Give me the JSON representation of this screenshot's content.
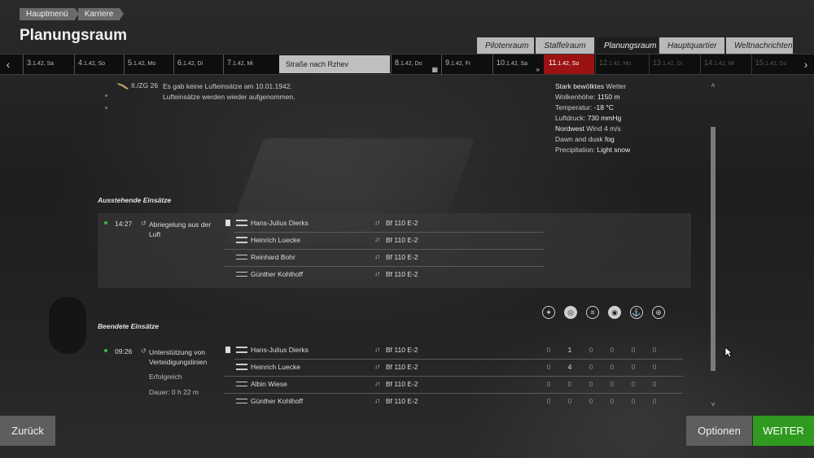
{
  "breadcrumb": [
    "Hauptmenü",
    "Karriere"
  ],
  "page_title": "Planungsraum",
  "tabs": [
    {
      "label": "Pilotenraum",
      "active": false
    },
    {
      "label": "Staffelraum",
      "active": false
    },
    {
      "label": "Planungsraum",
      "active": true
    },
    {
      "label": "Hauptquartier",
      "active": false
    },
    {
      "label": "Weltnachrichten",
      "active": false
    }
  ],
  "datebar": {
    "days": [
      {
        "num": "3",
        "rest": ".1.42, Sa"
      },
      {
        "num": "4",
        "rest": ".1.42, So"
      },
      {
        "num": "5",
        "rest": ".1.42, Mo"
      },
      {
        "num": "6",
        "rest": ".1.42, Di"
      },
      {
        "num": "7",
        "rest": ".1.42, Mi"
      },
      {
        "num": "8",
        "rest": ".1.42, Do"
      },
      {
        "num": "9",
        "rest": ".1.42, Fr"
      },
      {
        "num": "10",
        "rest": ".1.42, Sa"
      },
      {
        "num": "11",
        "rest": ".1.42, So"
      },
      {
        "num": "12",
        "rest": ".1.42, Mo"
      },
      {
        "num": "13",
        "rest": ".1.42, Di"
      },
      {
        "num": "14",
        "rest": ".1.42, Mi"
      },
      {
        "num": "15",
        "rest": ".1.42, Do"
      }
    ],
    "route": "Straße nach Rzhev",
    "prev_icon": "chevron-left-icon",
    "next_icon": "chevron-right-icon"
  },
  "report": {
    "unit": "II./ZG 26",
    "lines": [
      "Es gab keine Lufteinsätze am 10.01.1942.",
      "Lufteinsätze werden wieder aufgenommen."
    ]
  },
  "weather": {
    "line1_bold": "Stark bewölktes",
    "line1_rest": " Wetter",
    "line2_label": "Wolkenhöhe: ",
    "line2_value": "1150 m",
    "line3_label": "Temperatur: ",
    "line3_value": "-18 °C",
    "line4_label": "Luftdruck: ",
    "line4_value": "730 mmHg",
    "line5_bold": "Nordwest",
    "line5_rest": " Wind 4 m/s",
    "line6_rest": "Dawn and dusk ",
    "line6_bold": "fog",
    "line7_label": "Precipitation: ",
    "line7_value": "Light snow"
  },
  "pending": {
    "label": "Ausstehende Einsätze",
    "time": "14:27",
    "name": "Abriegelung aus der Luft",
    "crew": [
      {
        "pilot": "Hans-Julius Dierks",
        "plane": "Bf 110 E-2"
      },
      {
        "pilot": "Heinrich Luecke",
        "plane": "Bf 110 E-2"
      },
      {
        "pilot": "Reinhard Bohr",
        "plane": "Bf 110 E-2"
      },
      {
        "pilot": "Günther Kohlhoff",
        "plane": "Bf 110 E-2"
      }
    ]
  },
  "completed": {
    "label": "Beendete Einsätze",
    "time": "09:26",
    "name": "Unterstützung von Verteidigungslinien",
    "result": "Erfolgreich",
    "duration": "Dauer: 0 h 22 m",
    "stat_icons": [
      "aircraft-kills-icon",
      "ground-target-icon",
      "armored-target-icon",
      "naval-target-icon",
      "ship-target-icon",
      "static-target-icon"
    ],
    "crew": [
      {
        "pilot": "Hans-Julius Dierks",
        "plane": "Bf 110 E-2",
        "stats": [
          "0",
          "1",
          "0",
          "0",
          "0",
          "0"
        ]
      },
      {
        "pilot": "Heinrich Luecke",
        "plane": "Bf 110 E-2",
        "stats": [
          "0",
          "4",
          "0",
          "0",
          "0",
          "0"
        ]
      },
      {
        "pilot": "Albin Wiese",
        "plane": "Bf 110 E-2",
        "stats": [
          "0",
          "0",
          "0",
          "0",
          "0",
          "0"
        ]
      },
      {
        "pilot": "Günther Kohlhoff",
        "plane": "Bf 110 E-2",
        "stats": [
          "0",
          "0",
          "0",
          "0",
          "0",
          "0"
        ]
      }
    ]
  },
  "buttons": {
    "back": "Zurück",
    "options": "Optionen",
    "continue": "WEITER"
  },
  "colors": {
    "active_day": "#9b1212",
    "continue_button": "#2f9a1f",
    "status_dot": "#3fb63f"
  }
}
